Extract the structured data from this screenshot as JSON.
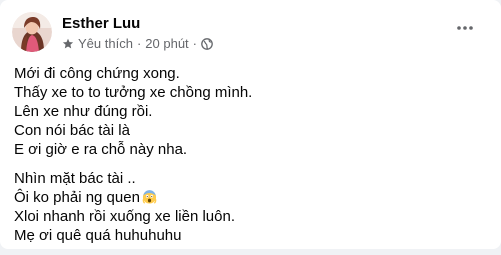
{
  "post": {
    "author": "Esther Luu",
    "meta": {
      "star_icon": "star-icon",
      "label": "Yêu thích",
      "separator": "·",
      "time": "20 phút",
      "audience_icon": "globe-icon"
    },
    "more_icon": "more-options-icon",
    "paragraphs": [
      {
        "lines": [
          "Mới đi công chứng xong.",
          "Thấy xe to to tưởng xe chồng mình.",
          "Lên xe như đúng rồi.",
          "Con nói bác tài là",
          "E ơi giờ e ra chỗ này nha."
        ]
      },
      {
        "lines": [
          "Nhìn mặt bác tài ..",
          "Ôi ko phải ng quen",
          "Xloi nhanh rồi xuống xe liền luôn.",
          "Mẹ ơi quê quá huhuhuhu"
        ]
      }
    ],
    "emoji_icon": "screaming-face-emoji"
  }
}
